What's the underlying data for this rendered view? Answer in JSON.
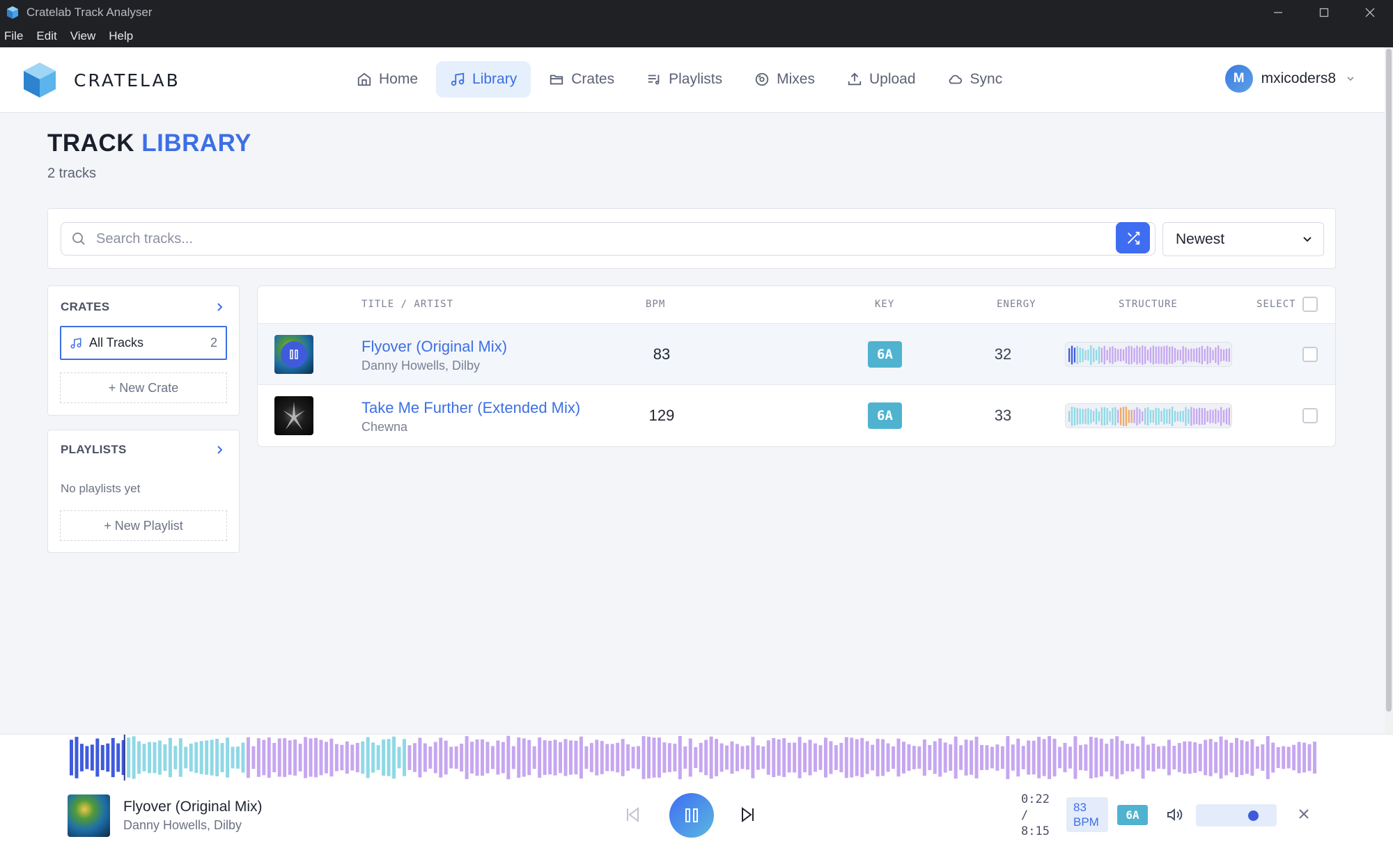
{
  "window": {
    "title": "Cratelab Track Analyser"
  },
  "menu": [
    "File",
    "Edit",
    "View",
    "Help"
  ],
  "nav": {
    "logo": "CRATELAB",
    "items": [
      {
        "label": "Home",
        "icon": "home-icon"
      },
      {
        "label": "Library",
        "icon": "music-note-icon",
        "active": true
      },
      {
        "label": "Crates",
        "icon": "folder-icon"
      },
      {
        "label": "Playlists",
        "icon": "playlist-icon"
      },
      {
        "label": "Mixes",
        "icon": "disc-icon"
      },
      {
        "label": "Upload",
        "icon": "upload-icon"
      },
      {
        "label": "Sync",
        "icon": "cloud-icon"
      }
    ],
    "user": {
      "initial": "M",
      "name": "mxicoders8"
    }
  },
  "page": {
    "title_main": "TRACK",
    "title_accent": "LIBRARY",
    "count_text": "2 tracks"
  },
  "search": {
    "placeholder": "Search tracks...",
    "sort": "Newest"
  },
  "crates": {
    "heading": "CRATES",
    "all_label": "All Tracks",
    "all_count": "2",
    "new_label": "+ New Crate"
  },
  "playlists": {
    "heading": "PLAYLISTS",
    "empty": "No playlists yet",
    "new_label": "+ New Playlist"
  },
  "table": {
    "headers": {
      "title": "TITLE / ARTIST",
      "bpm": "BPM",
      "key": "KEY",
      "energy": "ENERGY",
      "structure": "STRUCTURE",
      "select": "SELECT"
    },
    "rows": [
      {
        "title": "Flyover (Original Mix)",
        "artist": "Danny Howells, Dilby",
        "bpm": "83",
        "key": "6A",
        "energy": "32",
        "playing": true
      },
      {
        "title": "Take Me Further (Extended Mix)",
        "artist": "Chewna",
        "bpm": "129",
        "key": "6A",
        "energy": "33",
        "playing": false
      }
    ]
  },
  "player": {
    "title": "Flyover (Original Mix)",
    "artist": "Danny Howells, Dilby",
    "elapsed": "0:22",
    "sep": "/",
    "duration": "8:15",
    "bpm": "83",
    "bpm_unit": "BPM",
    "key": "6A",
    "progress": 0.044,
    "volume": 0.75
  },
  "colors": {
    "accent": "#3d6fe4",
    "key_badge": "#4fb3cf",
    "played": "#3f5bdc",
    "wave_cyan": "#8fd8e6",
    "wave_purple": "#c6a6f0"
  }
}
